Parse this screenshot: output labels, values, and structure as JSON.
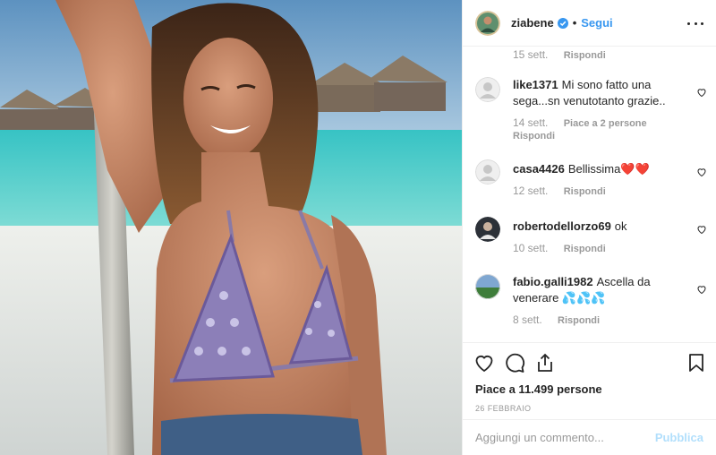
{
  "header": {
    "username": "ziabene",
    "separator": "•",
    "follow_label": "Segui",
    "verified_icon": "verified-badge-icon",
    "more_icon": "more-options-icon"
  },
  "comments": [
    {
      "user": "",
      "text": "",
      "time": "15 sett.",
      "likes": "",
      "reply": "Rispondi",
      "partial": true
    },
    {
      "user": "like1371",
      "text": "Mi sono fatto una sega...sn venutotanto grazie..",
      "time": "14 sett.",
      "likes": "Piace a 2 persone",
      "reply": "Rispondi"
    },
    {
      "user": "casa4426",
      "text": "Bellissima❤️❤️",
      "time": "12 sett.",
      "likes": "",
      "reply": "Rispondi"
    },
    {
      "user": "robertodellorzo69",
      "text": "ok",
      "time": "10 sett.",
      "likes": "",
      "reply": "Rispondi"
    },
    {
      "user": "fabio.galli1982",
      "text": "Ascella da venerare 💦💦💦",
      "time": "8 sett.",
      "likes": "",
      "reply": "Rispondi"
    }
  ],
  "actions": {
    "like_icon": "heart-icon",
    "comment_icon": "comment-icon",
    "share_icon": "share-icon",
    "save_icon": "bookmark-icon"
  },
  "likes_label": "Piace a 11.499 persone",
  "date_label": "26 FEBBRAIO",
  "add_comment": {
    "placeholder": "Aggiungi un commento...",
    "publish_label": "Pubblica"
  },
  "colors": {
    "link_blue": "#3897f0",
    "publish_disabled": "#b2dffc",
    "heart_red": "#e0223a",
    "muted": "#999999",
    "border": "#efefef"
  }
}
